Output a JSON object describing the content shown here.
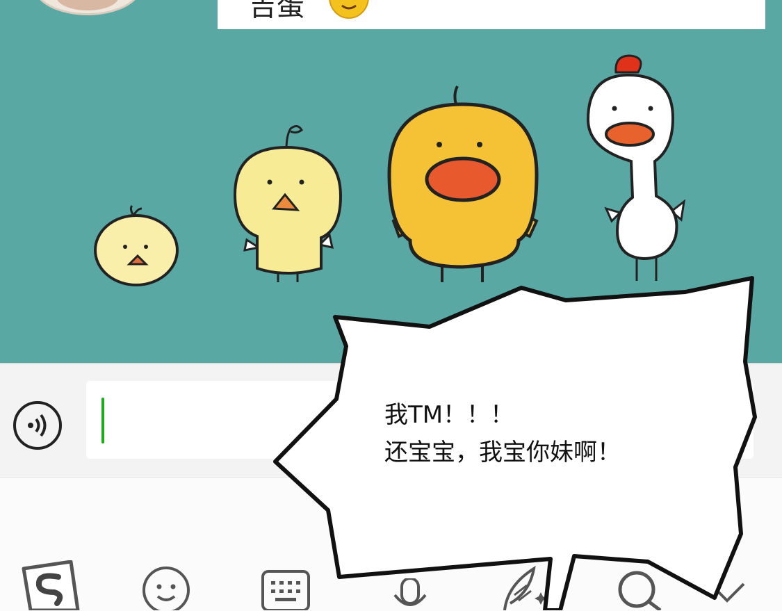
{
  "chat": {
    "message_text": "吉蛋",
    "emoji_name": "yellow-face-emoji"
  },
  "sticker": {
    "description_name": "chick-growth-sticker"
  },
  "input": {
    "value": ""
  },
  "keyboard_toolbar": {
    "icons": [
      "sogou-logo-icon",
      "smiley-icon",
      "keyboard-icon",
      "microphone-icon",
      "feather-icon",
      "search-icon",
      "chevron-down-icon"
    ]
  },
  "speech_bubble": {
    "line1": "我TM！！！",
    "line2": "还宝宝，我宝你妹啊！"
  },
  "colors": {
    "chat_background": "#5aa8a4",
    "cursor": "#1aad19"
  }
}
